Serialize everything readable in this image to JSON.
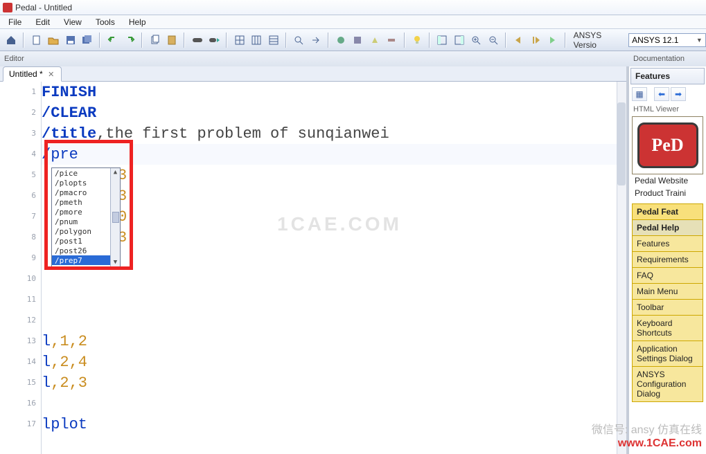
{
  "window": {
    "title": "Pedal - Untitled"
  },
  "menu": [
    "File",
    "Edit",
    "View",
    "Tools",
    "Help"
  ],
  "toolbar": {
    "version_label": "ANSYS Versio",
    "version_selected": "ANSYS 12.1"
  },
  "panels": {
    "editor_label": "Editor",
    "doc_label": "Documentation"
  },
  "tab": {
    "label": "Untitled *"
  },
  "code": {
    "lines": [
      {
        "n": 1,
        "kind": "kw",
        "text": "FINISH"
      },
      {
        "n": 2,
        "kind": "kw",
        "text": "/CLEAR"
      },
      {
        "n": 3,
        "kind": "mix",
        "cmd": "/title",
        "sep": ",",
        "rest": "the first problem of sunqianwei"
      },
      {
        "n": 4,
        "kind": "cmd",
        "text": "/pre"
      },
      {
        "n": 5,
        "kind": "num",
        "text": "3"
      },
      {
        "n": 6,
        "kind": "num",
        "text": "3"
      },
      {
        "n": 7,
        "kind": "num",
        "text": "0"
      },
      {
        "n": 8,
        "kind": "num",
        "text": "3"
      },
      {
        "n": 9,
        "kind": "blank",
        "text": ""
      },
      {
        "n": 10,
        "kind": "blank",
        "text": ""
      },
      {
        "n": 11,
        "kind": "blank",
        "text": ""
      },
      {
        "n": 12,
        "kind": "blank",
        "text": ""
      },
      {
        "n": 13,
        "kind": "l",
        "cmd": "l",
        "args": ",1,2"
      },
      {
        "n": 14,
        "kind": "l",
        "cmd": "l",
        "args": ",2,4"
      },
      {
        "n": 15,
        "kind": "l",
        "cmd": "l",
        "args": ",2,3"
      },
      {
        "n": 16,
        "kind": "blank",
        "text": ""
      },
      {
        "n": 17,
        "kind": "cmd",
        "text": "lplot"
      }
    ]
  },
  "autocomplete": {
    "items": [
      "/pice",
      "/plopts",
      "/pmacro",
      "/pmeth",
      "/pmore",
      "/pnum",
      "/polygon",
      "/post1",
      "/post26"
    ],
    "selected": "/prep7"
  },
  "side": {
    "features_label": "Features",
    "html_viewer": "HTML Viewer",
    "logo_text": "PeD",
    "links": [
      "Pedal Website",
      "Product Traini"
    ],
    "feat_header": "Pedal Feat",
    "items": [
      "Pedal Help",
      "Features",
      "Requirements",
      "FAQ",
      "Main Menu",
      "Toolbar",
      "Keyboard Shortcuts",
      "Application Settings Dialog",
      "ANSYS Configuration Dialog"
    ]
  },
  "watermark": "1CAE.COM",
  "footer1": "微信号: ansy 仿真在线",
  "footer2": "www.1CAE.com"
}
